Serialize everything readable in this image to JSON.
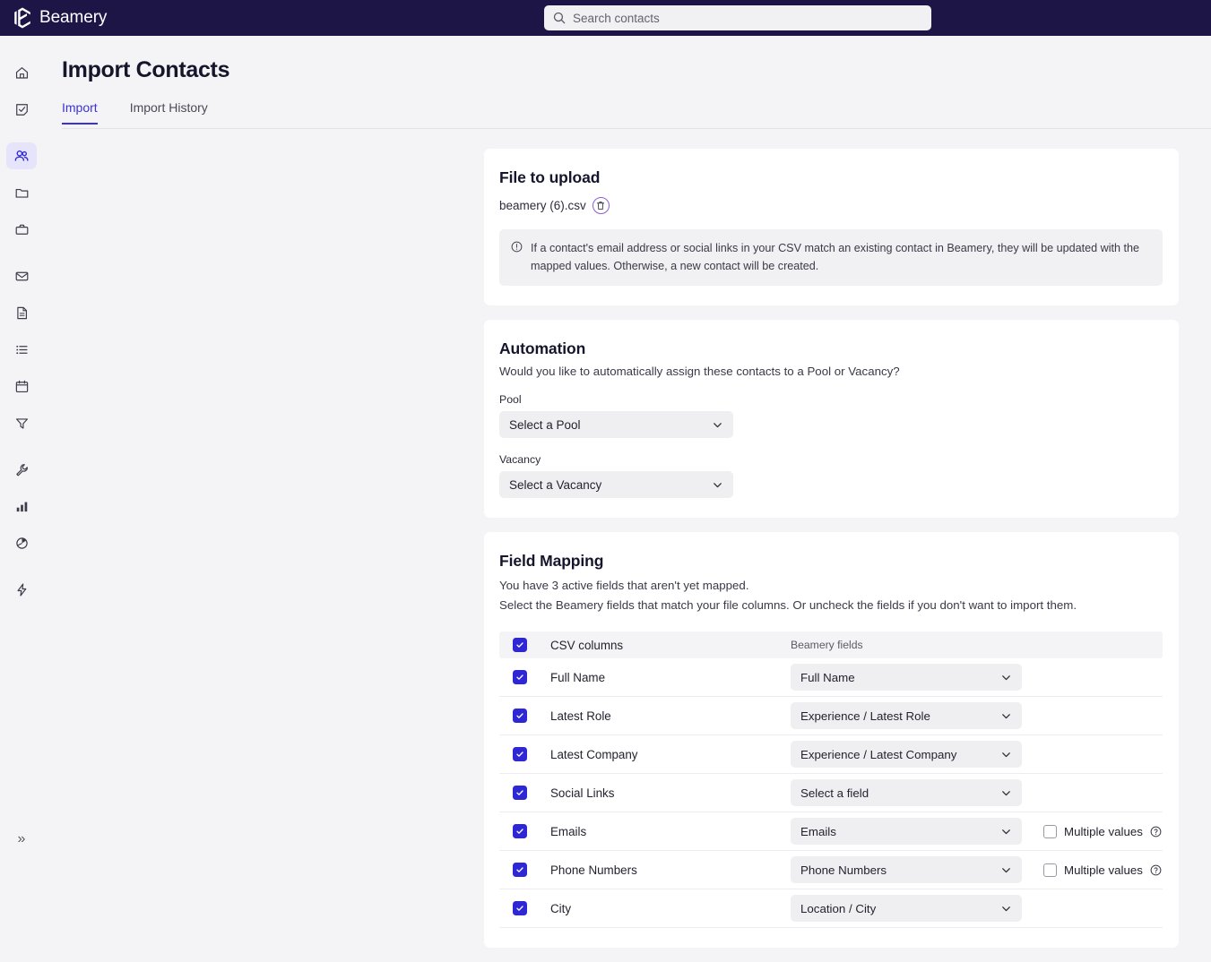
{
  "topbar": {
    "brand": "Beamery",
    "logo_icon": "beamery-hex-logo",
    "search": {
      "placeholder": "Search contacts",
      "value": "",
      "icon": "search-icon"
    },
    "background_color": "#1e1547"
  },
  "sidebar": {
    "collapse_label": "»",
    "collapse_icon": "chevron-double-right-icon",
    "active_color": "#2f27d4",
    "active_bg": "#e6e4fb",
    "groups": [
      {
        "items": [
          {
            "name": "home",
            "icon": "home-icon",
            "active": false
          },
          {
            "name": "tasks",
            "icon": "checkbox-note-icon",
            "active": false
          }
        ]
      },
      {
        "items": [
          {
            "name": "contacts",
            "icon": "people-icon",
            "active": true
          },
          {
            "name": "pools",
            "icon": "folder-icon",
            "active": false
          },
          {
            "name": "vacancies",
            "icon": "briefcase-icon",
            "active": false
          }
        ]
      },
      {
        "items": [
          {
            "name": "messages",
            "icon": "envelope-icon",
            "active": false
          },
          {
            "name": "documents",
            "icon": "document-icon",
            "active": false
          },
          {
            "name": "lists",
            "icon": "list-icon",
            "active": false
          },
          {
            "name": "calendar",
            "icon": "calendar-icon",
            "active": false
          },
          {
            "name": "filters",
            "icon": "funnel-icon",
            "active": false
          }
        ]
      },
      {
        "items": [
          {
            "name": "settings",
            "icon": "wrench-icon",
            "active": false
          },
          {
            "name": "analytics",
            "icon": "bar-chart-icon",
            "active": false
          },
          {
            "name": "reports",
            "icon": "pie-chart-icon",
            "active": false
          }
        ]
      },
      {
        "items": [
          {
            "name": "automations",
            "icon": "lightning-bolt-icon",
            "active": false
          }
        ]
      }
    ]
  },
  "page": {
    "title": "Import Contacts",
    "tabs": [
      {
        "label": "Import",
        "active": true
      },
      {
        "label": "Import History",
        "active": false
      }
    ]
  },
  "file_to_upload": {
    "title": "File to upload",
    "filename": "beamery (6).csv",
    "delete_icon": "trash-icon",
    "notice_icon": "info-exclamation-icon",
    "notice": "If a contact's email address or social links in your CSV match an existing contact in Beamery, they will be updated with the mapped values. Otherwise, a new contact will be created."
  },
  "automation": {
    "title": "Automation",
    "subtitle": "Would you like to automatically assign these contacts to a Pool or Vacancy?",
    "pool_label": "Pool",
    "pool_value": "Select a Pool",
    "vacancy_label": "Vacancy",
    "vacancy_value": "Select a Vacancy",
    "chevron_icon": "chevron-down-icon"
  },
  "field_mapping": {
    "title": "Field Mapping",
    "line1": "You have 3 active fields that aren't yet mapped.",
    "line2": "Select the Beamery fields that match your file columns. Or uncheck the fields if you don't want to import them.",
    "columns": {
      "csv": "CSV columns",
      "beamery": "Beamery fields"
    },
    "select_all_checked": true,
    "multiple_values_label": "Multiple values",
    "help_icon": "question-circle-icon",
    "rows": [
      {
        "checked": true,
        "csv": "Full Name",
        "field": "Full Name",
        "has_multiple": false,
        "multiple_checked": false
      },
      {
        "checked": true,
        "csv": "Latest Role",
        "field": "Experience / Latest Role",
        "has_multiple": false,
        "multiple_checked": false
      },
      {
        "checked": true,
        "csv": "Latest Company",
        "field": "Experience / Latest Company",
        "has_multiple": false,
        "multiple_checked": false
      },
      {
        "checked": true,
        "csv": "Social Links",
        "field": "Select a field",
        "has_multiple": false,
        "multiple_checked": false
      },
      {
        "checked": true,
        "csv": "Emails",
        "field": "Emails",
        "has_multiple": true,
        "multiple_checked": false
      },
      {
        "checked": true,
        "csv": "Phone Numbers",
        "field": "Phone Numbers",
        "has_multiple": true,
        "multiple_checked": false
      },
      {
        "checked": true,
        "csv": "City",
        "field": "Location / City",
        "has_multiple": false,
        "multiple_checked": false
      }
    ]
  }
}
